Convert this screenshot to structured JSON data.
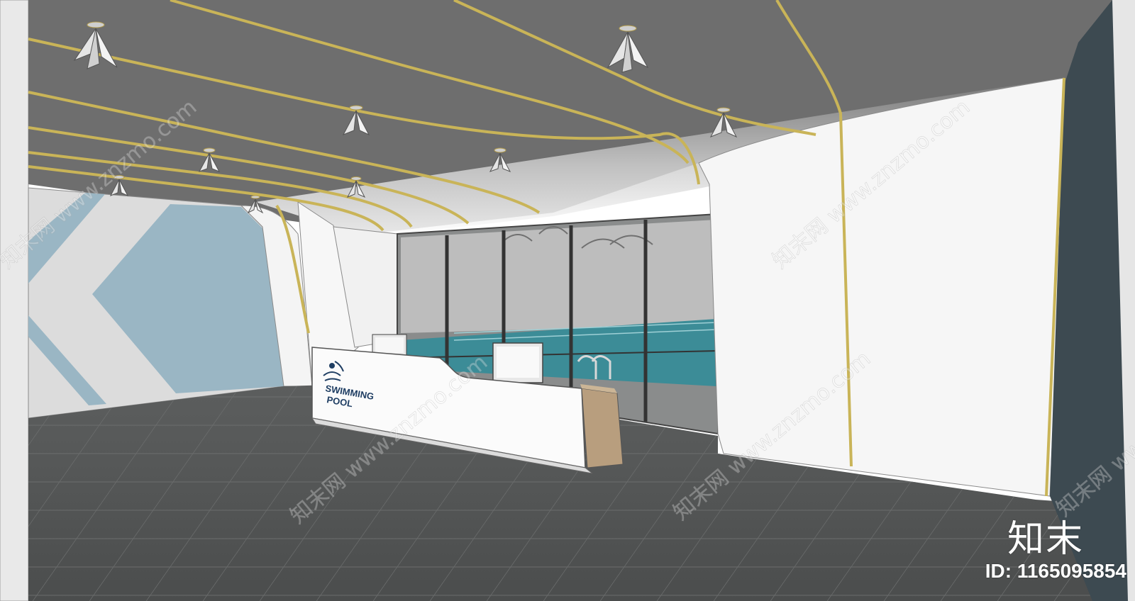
{
  "image": {
    "description_hidden": true
  },
  "reception_sign": {
    "line1": "SWIMMING",
    "line2": "POOL"
  },
  "brand": {
    "mark": "知末",
    "id_text": "ID: 1165095854"
  },
  "watermarks": {
    "text": "知末网 www.znzmo.com"
  },
  "colors": {
    "ceiling": "#6e6e6e",
    "floor": "#555757",
    "gold_strip": "#c9b458",
    "wall_blue": "#9ab6c4",
    "dark_wall": "#3d4a51",
    "pool_water": "#3c8c97"
  }
}
